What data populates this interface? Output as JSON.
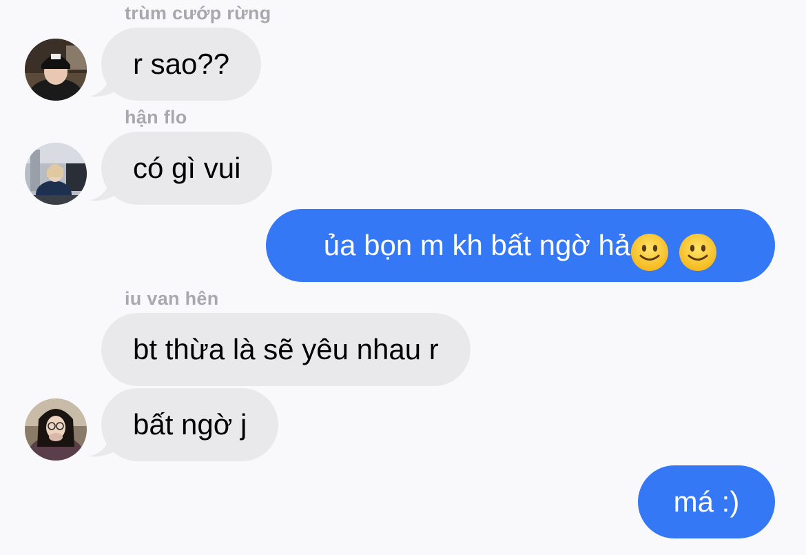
{
  "messages": [
    {
      "sender": "trùm cướp rừng",
      "text": "r sao??",
      "direction": "incoming",
      "avatar_icon": "user-avatar-dark-hat"
    },
    {
      "sender": "hận flo",
      "text": "có gì vui",
      "direction": "incoming",
      "avatar_icon": "user-avatar-office"
    },
    {
      "text": "ủa bọn m kh bất ngờ hả",
      "emoji": [
        "🙂",
        "🙂"
      ],
      "direction": "outgoing"
    },
    {
      "sender": "iu van hên",
      "text": "bt thừa là sẽ yêu nhau r",
      "direction": "incoming"
    },
    {
      "text": "bất ngờ j",
      "direction": "incoming",
      "avatar_icon": "user-avatar-glasses"
    },
    {
      "text": "má :)",
      "direction": "outgoing"
    }
  ],
  "colors": {
    "background": "#f9f9fb",
    "incoming_bubble": "#e9e9eb",
    "outgoing_bubble": "#3478f6",
    "sender_name": "#a8a8ad"
  }
}
